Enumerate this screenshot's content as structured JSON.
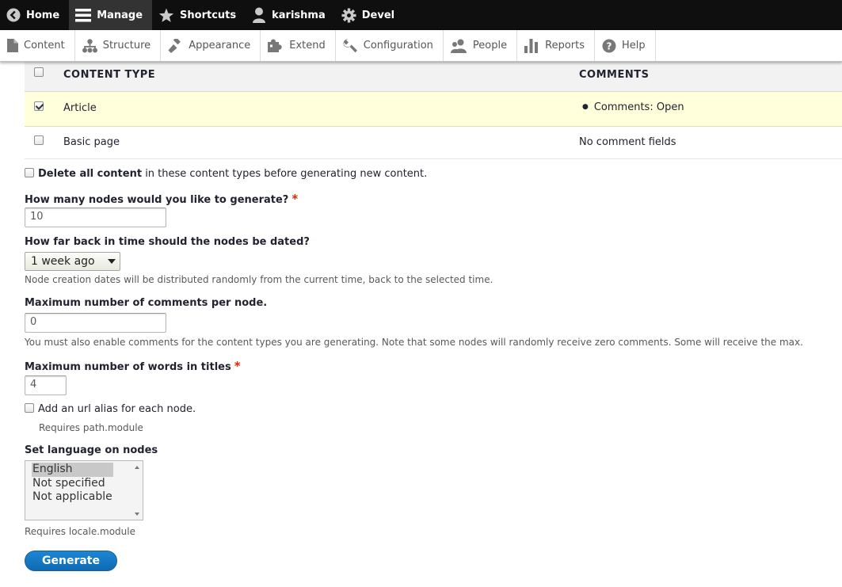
{
  "toolbar": {
    "items": [
      {
        "label": "Home",
        "icon": "back-arrow-circle-icon"
      },
      {
        "label": "Manage",
        "icon": "hamburger-menu-icon",
        "active": true
      },
      {
        "label": "Shortcuts",
        "icon": "star-icon"
      },
      {
        "label": "karishma",
        "icon": "user-icon"
      },
      {
        "label": "Devel",
        "icon": "gear-icon"
      }
    ]
  },
  "tray": {
    "items": [
      {
        "label": "Content",
        "icon": "file-icon"
      },
      {
        "label": "Structure",
        "icon": "sitemap-icon"
      },
      {
        "label": "Appearance",
        "icon": "paintbrush-icon"
      },
      {
        "label": "Extend",
        "icon": "puzzle-icon"
      },
      {
        "label": "Configuration",
        "icon": "wrench-icon"
      },
      {
        "label": "People",
        "icon": "people-icon"
      },
      {
        "label": "Reports",
        "icon": "bar-chart-icon"
      },
      {
        "label": "Help",
        "icon": "help-icon"
      }
    ]
  },
  "content_types": {
    "headers": {
      "type": "CONTENT TYPE",
      "comments": "COMMENTS"
    },
    "rows": [
      {
        "name": "Article",
        "comments": "Comments: Open",
        "checked": true
      },
      {
        "name": "Basic page",
        "comments": "No comment fields",
        "checked": false
      }
    ]
  },
  "form": {
    "delete_all": {
      "bold": "Delete all content",
      "rest": "in these content types before generating new content.",
      "checked": false
    },
    "num_nodes": {
      "label": "How many nodes would you like to generate?",
      "required": "*",
      "value": "10"
    },
    "time_range": {
      "label": "How far back in time should the nodes be dated?",
      "selected": "1 week ago",
      "description": "Node creation dates will be distributed randomly from the current time, back to the selected time."
    },
    "max_comments": {
      "label": "Maximum number of comments per node.",
      "value": "0",
      "description": "You must also enable comments for the content types you are generating. Note that some nodes will randomly receive zero comments. Some will receive the max."
    },
    "title_length": {
      "label": "Maximum number of words in titles",
      "required": "*",
      "value": "4"
    },
    "add_alias": {
      "label": "Add an url alias for each node.",
      "description": "Requires path.module",
      "checked": false
    },
    "language": {
      "label": "Set language on nodes",
      "options": [
        "English",
        "Not specified",
        "Not applicable"
      ],
      "selected": "English",
      "description": "Requires locale.module"
    },
    "submit_label": "Generate"
  },
  "colors": {
    "toolbar_bg": "#0f0f0f",
    "selected_row": "#ffffdc",
    "required_star": "#e62600",
    "primary_button": "#1478c8"
  }
}
